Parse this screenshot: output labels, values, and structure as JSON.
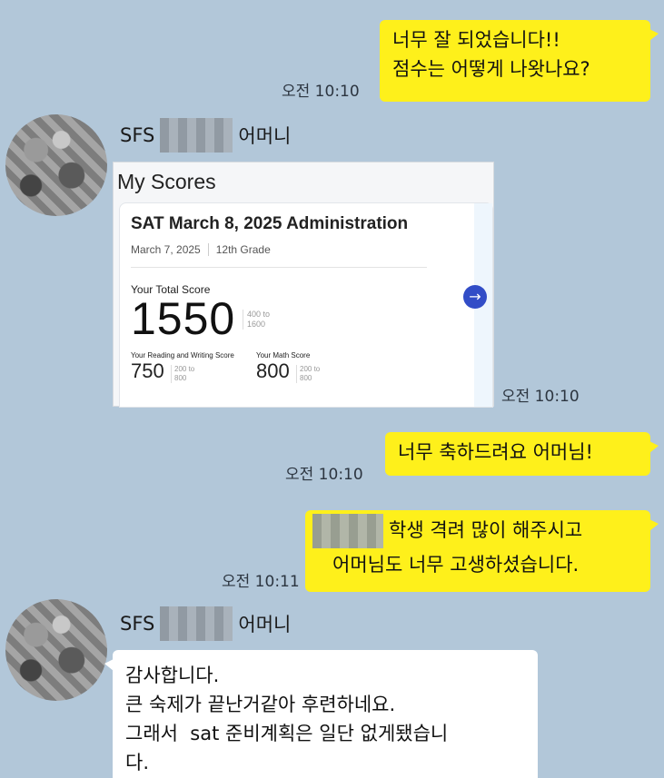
{
  "messages": {
    "m1": {
      "text": "너무 잘 되었습니다!!\n점수는 어떻게 나왓나요?",
      "time": "오전 10:10"
    },
    "m2": {
      "sender": "SFS",
      "sender_suffix": "어머니",
      "time": "오전 10:10"
    },
    "m3": {
      "text": "너무 축하드려요 어머님!",
      "time": "오전 10:10"
    },
    "m4": {
      "line1": "학생 격려 많이 해주시고",
      "line2": "어머님도 너무 고생하셨습니다.",
      "time": "오전 10:11"
    },
    "m5": {
      "sender": "SFS",
      "sender_suffix": "어머니",
      "text": "감사합니다.\n큰 숙제가 끝난거같아 후련하네요.\n그래서  sat 준비계획은 일단 없게됐습니\n다."
    }
  },
  "score_card": {
    "heading": "My Scores",
    "administration": "SAT March 8, 2025 Administration",
    "date": "March 7, 2025",
    "grade": "12th Grade",
    "total_label": "Your Total Score",
    "total": "1550",
    "total_range_line1": "400 to",
    "total_range_line2": "1600",
    "rw_label": "Your Reading and Writing Score",
    "rw_score": "750",
    "math_label": "Your Math Score",
    "math_score": "800",
    "section_range_line1": "200 to",
    "section_range_line2": "800",
    "arrow_icon": "→"
  },
  "colors": {
    "background": "#b2c7d9",
    "my_bubble": "#fef01b",
    "their_bubble": "#ffffff",
    "accent": "#324dc7"
  }
}
